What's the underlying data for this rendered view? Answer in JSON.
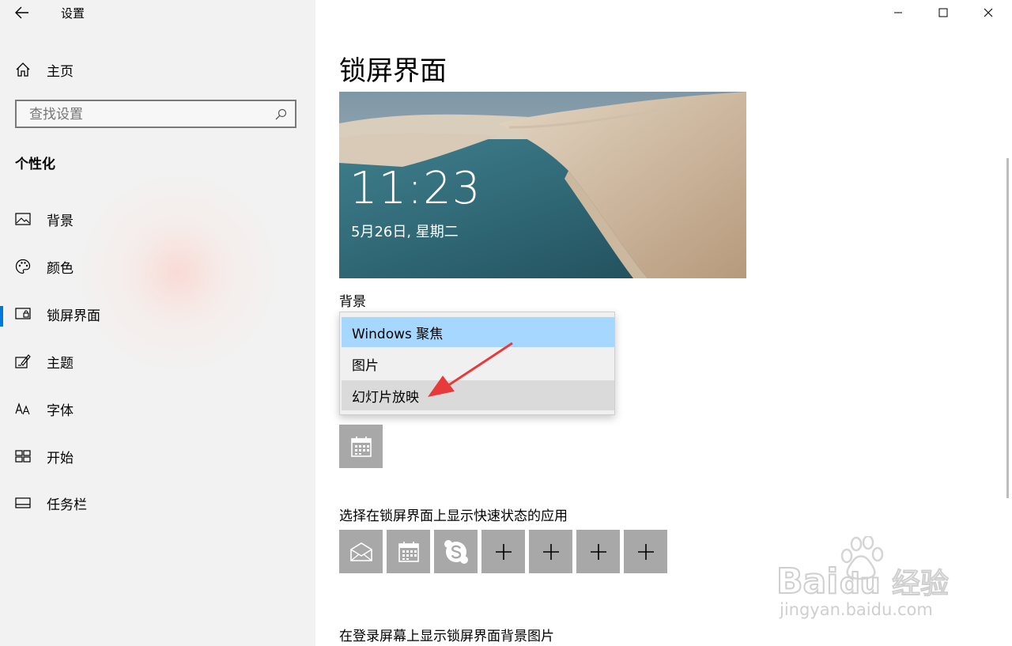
{
  "window": {
    "title": "设置"
  },
  "sidebar": {
    "home_label": "主页",
    "search_placeholder": "查找设置",
    "section_title": "个性化",
    "items": [
      {
        "label": "背景",
        "icon": "image-icon"
      },
      {
        "label": "颜色",
        "icon": "palette-icon"
      },
      {
        "label": "锁屏界面",
        "icon": "lock-screen-icon",
        "active": true
      },
      {
        "label": "主题",
        "icon": "theme-icon"
      },
      {
        "label": "字体",
        "icon": "font-icon"
      },
      {
        "label": "开始",
        "icon": "start-icon"
      },
      {
        "label": "任务栏",
        "icon": "taskbar-icon"
      }
    ]
  },
  "main": {
    "title": "锁屏界面",
    "preview": {
      "time": "11:23",
      "date": "5月26日, 星期二"
    },
    "background_label": "背景",
    "dropdown_options": [
      "Windows 聚焦",
      "图片",
      "幻灯片放映"
    ],
    "dropdown_selected": "Windows 聚焦",
    "dropdown_hovered": "幻灯片放映",
    "detailed_status_app_icon": "calendar-icon",
    "quick_status_label": "选择在锁屏界面上显示快速状态的应用",
    "quick_status_apps": [
      "mail-icon",
      "calendar-icon",
      "skype-icon",
      "plus-icon",
      "plus-icon",
      "plus-icon",
      "plus-icon"
    ],
    "login_label": "在登录屏幕上显示锁屏界面背景图片"
  },
  "colors": {
    "accent": "#0078d7",
    "selected_option": "#a6d8ff",
    "tile": "#a8a8a8",
    "arrow": "#e83a3a"
  },
  "watermark": {
    "text": "Bai经验",
    "url": "jingyan.baidu.com"
  }
}
